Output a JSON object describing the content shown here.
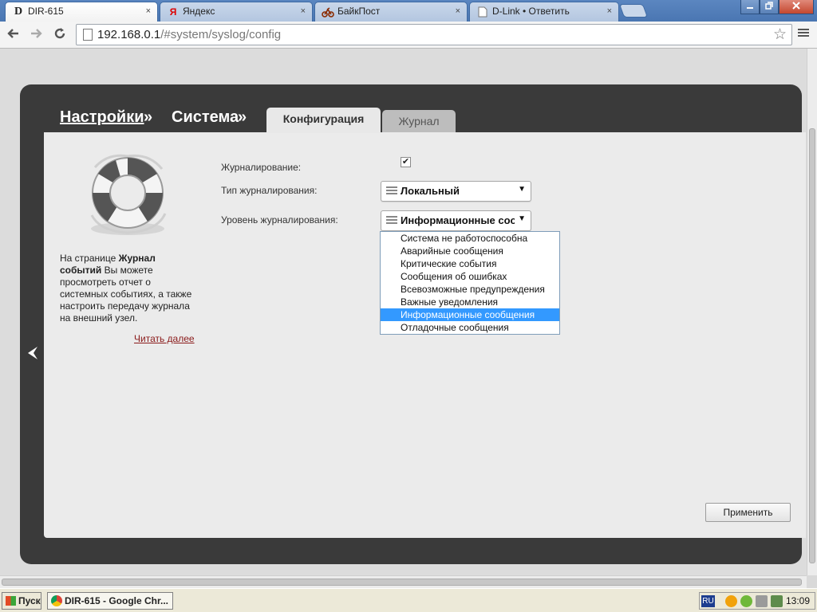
{
  "browser": {
    "tabs": [
      {
        "title": "DIR-615",
        "favicon": "D",
        "active": true
      },
      {
        "title": "Яндекс",
        "favicon": "Я",
        "active": false
      },
      {
        "title": "БайкПост",
        "favicon": "moto-icon",
        "active": false
      },
      {
        "title": "D-Link • Ответить",
        "favicon": "page-icon",
        "active": false
      }
    ],
    "tab_close_glyph": "×",
    "url_host": "192.168.0.1",
    "url_path": "/#system/syslog/config"
  },
  "router": {
    "breadcrumb": {
      "settings": "Настройки",
      "separator1": " »",
      "system": "Система",
      "separator2": " »"
    },
    "tabs": {
      "config": "Конфигурация",
      "log": "Журнал"
    },
    "sidebar": {
      "desc_prefix": "На странице ",
      "desc_bold": "Журнал событий",
      "desc_suffix": " Вы можете просмотреть отчет о системных событиях, а также настроить передачу журнала на внешний узел.",
      "read_more": "Читать далее"
    },
    "form": {
      "logging_label": "Журналирование:",
      "logging_checked": true,
      "logging_type_label": "Тип журналирования:",
      "logging_type_value": "Локальный",
      "logging_level_label": "Уровень журналирования:",
      "logging_level_value": "Информационные сообщения",
      "level_options": [
        "Система не работоспособна",
        "Аварийные сообщения",
        "Критические события",
        "Сообщения об ошибках",
        "Всевозможные предупреждения",
        "Важные уведомления",
        "Информационные сообщения",
        "Отладочные сообщения"
      ],
      "selected_option_index": 6,
      "apply_label": "Применить"
    }
  },
  "taskbar": {
    "start_label": "Пуск",
    "task_label": "DIR-615 - Google Chr...",
    "lang": "RU",
    "clock": "13:09"
  },
  "colors": {
    "selection": "#3399ff",
    "frame": "#3a3a3a",
    "read_more": "#8a1a1a"
  }
}
